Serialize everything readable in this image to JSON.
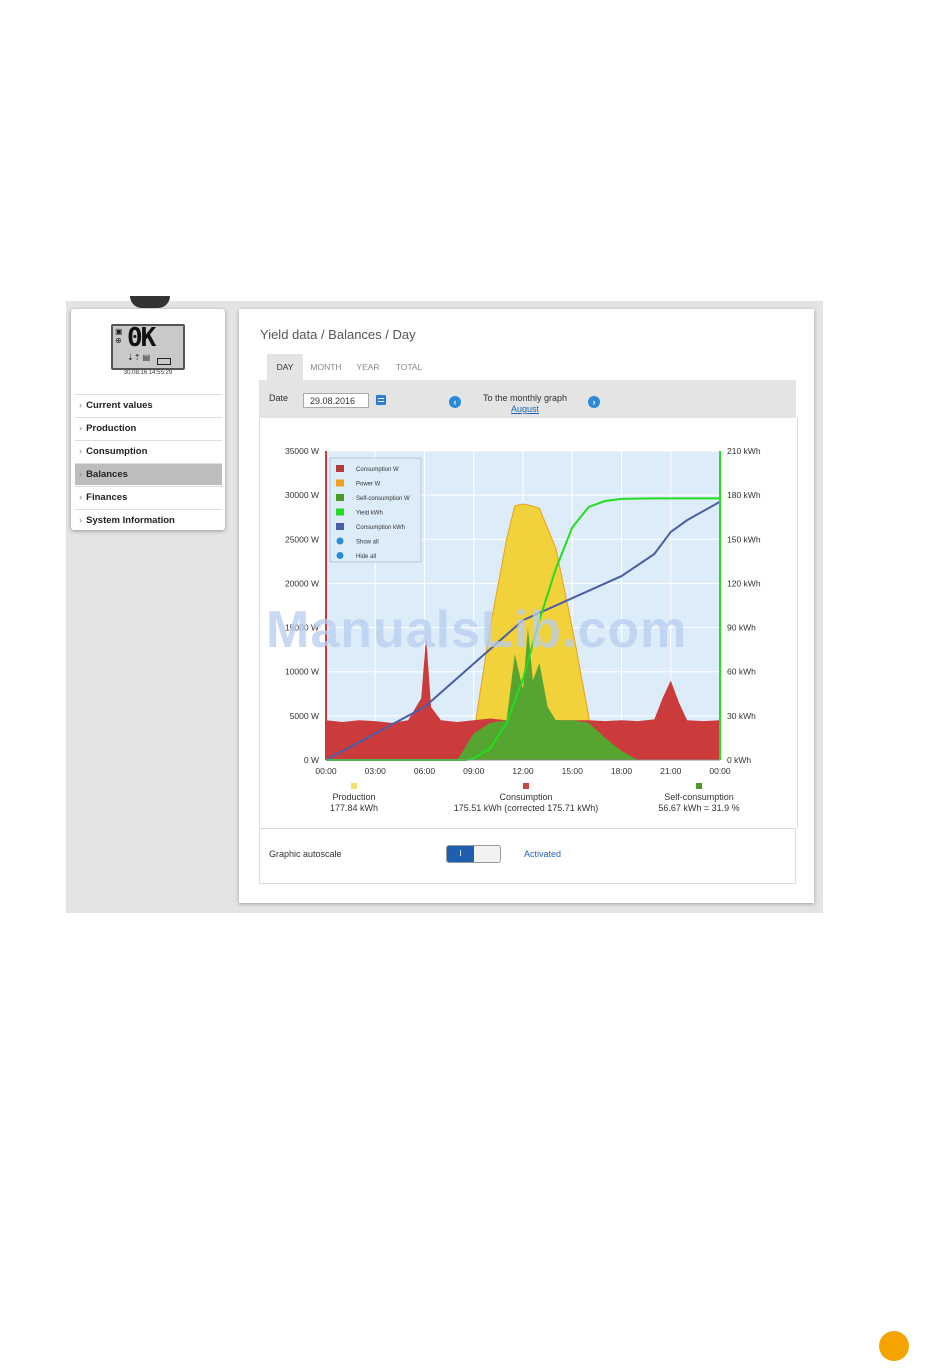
{
  "sidebar": {
    "display": {
      "main": "0K",
      "timestamp": "30.08.16 14:55:29"
    },
    "items": [
      {
        "label": "Current values",
        "active": false
      },
      {
        "label": "Production",
        "active": false
      },
      {
        "label": "Consumption",
        "active": false
      },
      {
        "label": "Balances",
        "active": true
      },
      {
        "label": "Finances",
        "active": false
      },
      {
        "label": "System Information",
        "active": false
      }
    ]
  },
  "main": {
    "breadcrumb": "Yield data / Balances / Day",
    "tabs": [
      {
        "label": "DAY",
        "active": true
      },
      {
        "label": "MONTH",
        "active": false
      },
      {
        "label": "YEAR",
        "active": false
      },
      {
        "label": "TOTAL",
        "active": false
      }
    ],
    "date_label": "Date",
    "date_value": "29.08.2016",
    "monthly_label": "To the monthly graph",
    "monthly_link": "August"
  },
  "chart_data": {
    "type": "area",
    "x_ticks": [
      "00:00",
      "03:00",
      "06:00",
      "09:00",
      "12:00",
      "15:00",
      "18:00",
      "21:00",
      "00:00"
    ],
    "y_left_ticks": [
      "0 W",
      "5000 W",
      "10000 W",
      "15000 W",
      "20000 W",
      "25000 W",
      "30000 W",
      "35000 W"
    ],
    "y_right_ticks": [
      "0 kWh",
      "30 kWh",
      "60 kWh",
      "90 kWh",
      "120 kWh",
      "150 kWh",
      "180 kWh",
      "210 kWh"
    ],
    "ylim_left": [
      0,
      35000
    ],
    "ylim_right": [
      0,
      210
    ],
    "xlim_hours": [
      0,
      24
    ],
    "legend": [
      {
        "label": "Consumption W",
        "color": "#b23c3c"
      },
      {
        "label": "Power W",
        "color": "#f0a020"
      },
      {
        "label": "Self-consumption W",
        "color": "#4a9a2a"
      },
      {
        "label": "Yield kWh",
        "color": "#22dd22"
      },
      {
        "label": "Consumption kWh",
        "color": "#4a5ea8"
      },
      {
        "label": "Show all",
        "icon": "eye-icon"
      },
      {
        "label": "Hide all",
        "icon": "eye-off-icon"
      }
    ],
    "series": [
      {
        "name": "Power W",
        "color": "#f2d23a",
        "x": [
          0,
          8.5,
          9,
          10,
          11,
          11.5,
          12,
          12.5,
          13,
          14,
          15,
          16,
          16.3,
          24
        ],
        "values": [
          0,
          0,
          3000,
          15000,
          25000,
          28800,
          29000,
          28800,
          28500,
          24000,
          15000,
          5000,
          0,
          0
        ]
      },
      {
        "name": "Consumption W",
        "color": "#cc3b3b",
        "x": [
          0,
          1,
          2,
          3,
          4,
          5,
          5.8,
          6.1,
          6.4,
          7,
          8,
          9,
          10,
          11,
          12,
          13,
          14,
          15,
          16,
          17,
          18,
          19,
          20,
          20.5,
          21,
          21.5,
          22,
          23,
          24
        ],
        "values": [
          4500,
          4300,
          4500,
          4400,
          4200,
          4500,
          7000,
          14000,
          6000,
          4500,
          4300,
          4500,
          4700,
          4500,
          4200,
          4600,
          4500,
          4500,
          4500,
          4400,
          4500,
          4400,
          4600,
          7000,
          9000,
          6500,
          4500,
          4400,
          4500
        ]
      },
      {
        "name": "Self-consumption W",
        "color": "#55a530",
        "x": [
          0,
          8,
          9,
          10,
          11,
          11.5,
          12,
          12.3,
          12.6,
          13,
          13.5,
          14,
          15,
          16,
          17,
          18,
          19,
          24
        ],
        "values": [
          0,
          0,
          3000,
          4200,
          4500,
          12000,
          8000,
          15000,
          9000,
          11000,
          6000,
          4500,
          4500,
          4200,
          2500,
          1000,
          0,
          0
        ]
      },
      {
        "name": "Yield kWh",
        "color": "#22dd22",
        "x": [
          0,
          8.5,
          9,
          10,
          11,
          12,
          13,
          14,
          15,
          16,
          17,
          18,
          20,
          24
        ],
        "values": [
          0,
          0,
          1,
          8,
          25,
          55,
          95,
          130,
          158,
          172,
          176,
          177.5,
          177.8,
          177.84
        ]
      },
      {
        "name": "Consumption kWh",
        "color": "#4a5ea8",
        "x": [
          0,
          6,
          12,
          18,
          20,
          21,
          22,
          24
        ],
        "values": [
          0,
          36,
          95,
          125,
          140,
          155,
          163,
          175.51
        ]
      }
    ],
    "summary": [
      {
        "label": "Production",
        "value": "177.84 kWh",
        "color": "#f2e26a"
      },
      {
        "label": "Consumption",
        "value": "175.51 kWh (corrected 175.71 kWh)",
        "color": "#cc4444"
      },
      {
        "label": "Self-consumption",
        "value": "56.67 kWh = 31.9 %",
        "color": "#4a9a2a"
      }
    ]
  },
  "autoscale": {
    "label": "Graphic autoscale",
    "toggle_text": "I",
    "state_label": "Activated"
  },
  "watermark": "ManualsLib.com"
}
